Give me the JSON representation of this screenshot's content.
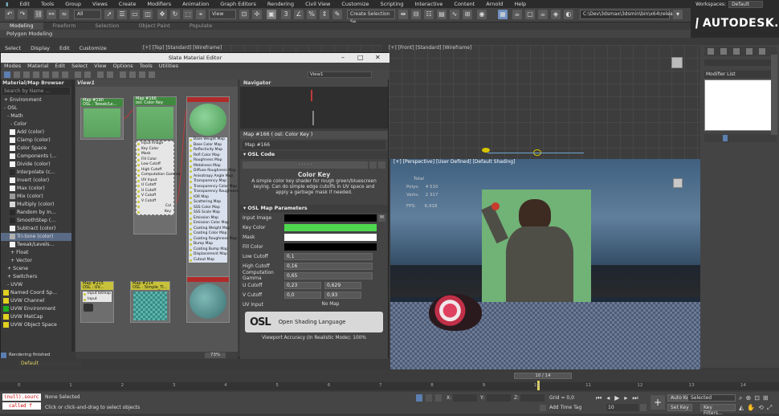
{
  "menubar": {
    "items": [
      "Edit",
      "Tools",
      "Group",
      "Views",
      "Create",
      "Modifiers",
      "Animation",
      "Graph Editors",
      "Rendering",
      "Civil View",
      "Customize",
      "Scripting",
      "Interactive",
      "Content",
      "Arnold",
      "Help"
    ],
    "file_icon": "F",
    "workspaces_label": "Workspaces:",
    "workspaces_value": "Default"
  },
  "toolbar": {
    "filter": "All",
    "view": "View",
    "selection_set": "Create Selection Se",
    "path": "C:\\Dev\\3dsmax\\3dsmin\\bin\\x64\\release"
  },
  "ribbon": {
    "tabs": [
      "Modeling",
      "Freeform",
      "Selection",
      "Object Paint",
      "Populate"
    ],
    "sub": "Polygon Modeling"
  },
  "brand": "AUTODESK.",
  "viewports": {
    "menu": [
      "Select",
      "Display",
      "Edit",
      "Customize"
    ],
    "top_label": "[+] [Top] [Standard] [Wireframe]",
    "front_label": "[+] [Front] [Standard] [Wireframe]",
    "persp_label": "[+] [Perspective] [User Defined] [Default Shading]",
    "stats": {
      "total_label": "Total",
      "polys_label": "Polys:",
      "polys": "4 510",
      "verts_label": "Verts:",
      "verts": "2 317",
      "fps_label": "FPS:",
      "fps": "6,918"
    }
  },
  "command_panel": {
    "modifier_list": "Modifier List"
  },
  "sme": {
    "title": "Slate Material Editor",
    "menu": [
      "Modes",
      "Material",
      "Edit",
      "Select",
      "View",
      "Options",
      "Tools",
      "Utilities"
    ],
    "view_dropdown": "View1",
    "browser": {
      "title": "Material/Map Browser",
      "search": "Search by Name ...",
      "items": [
        {
          "label": "+ Environment",
          "indent": 1,
          "swatch": ""
        },
        {
          "label": "- OSL",
          "indent": 1,
          "swatch": ""
        },
        {
          "label": "- Math",
          "indent": 2,
          "swatch": ""
        },
        {
          "label": "- Color",
          "indent": 3,
          "swatch": ""
        },
        {
          "label": "Add (color)",
          "indent": 5,
          "swatch": "#f4f4f4"
        },
        {
          "label": "Clamp (color)",
          "indent": 5,
          "swatch": "#f4f4f4"
        },
        {
          "label": "Color Space",
          "indent": 5,
          "swatch": "#f4f4f4"
        },
        {
          "label": "Components (...",
          "indent": 5,
          "swatch": "#f4f4f4"
        },
        {
          "label": "Divide (color)",
          "indent": 5,
          "swatch": "#f4f4f4"
        },
        {
          "label": "Interpolate (c...",
          "indent": 5,
          "swatch": "#2a2a2a"
        },
        {
          "label": "Invert (color)",
          "indent": 5,
          "swatch": "#f4f4f4"
        },
        {
          "label": "Max (color)",
          "indent": 5,
          "swatch": "#f4f4f4"
        },
        {
          "label": "Mix (color)",
          "indent": 5,
          "swatch": "#9a9a9a"
        },
        {
          "label": "Multiply (color)",
          "indent": 5,
          "swatch": "#d8d8d8"
        },
        {
          "label": "Random by In...",
          "indent": 5,
          "swatch": "#2a2a2a"
        },
        {
          "label": "SmoothStep (...",
          "indent": 5,
          "swatch": "#2a2a2a"
        },
        {
          "label": "Subtract (color)",
          "indent": 5,
          "swatch": "#f4f4f4"
        },
        {
          "label": "Tri-tone (color)",
          "indent": 5,
          "swatch": "#b0b0b0",
          "selected": true
        },
        {
          "label": "Tweak/Levels...",
          "indent": 5,
          "swatch": "#f4f4f4"
        },
        {
          "label": "+ Float",
          "indent": 3,
          "swatch": ""
        },
        {
          "label": "+ Vector",
          "indent": 3,
          "swatch": ""
        },
        {
          "label": "+ Scene",
          "indent": 2,
          "swatch": ""
        },
        {
          "label": "+ Switchers",
          "indent": 2,
          "swatch": ""
        },
        {
          "label": "- UVW",
          "indent": 2,
          "swatch": ""
        },
        {
          "label": "Named Coord Sp...",
          "indent": 3,
          "swatch": "#e0d020"
        },
        {
          "label": "UVW Channel",
          "indent": 3,
          "swatch": "#e0d020"
        },
        {
          "label": "UVW Environment",
          "indent": 3,
          "swatch": "#20b020"
        },
        {
          "label": "UVW MatCap",
          "indent": 3,
          "swatch": "#e0d020"
        },
        {
          "label": "UVW Object Space",
          "indent": 3,
          "swatch": "#e0d020"
        }
      ]
    },
    "view_tab": "View1",
    "nodes": {
      "n190": {
        "title": "Map #190",
        "sub": "OSL : Tweak/Le..."
      },
      "n166": {
        "title": "Map #166",
        "sub": "osl: Color Key",
        "slots": [
          "Input Image",
          "Key Color",
          "Mask",
          "Fill Color",
          "Low Cutoff",
          "High Cutoff",
          "Computation Gamma",
          "UV Input",
          "U Cutoff",
          "U Cutoff",
          "V Cutoff",
          "V Cutoff"
        ],
        "outs": [
          "Col",
          "Key"
        ]
      },
      "n3": {
        "title": "",
        "sub": "",
        "slots": [
          "Base Weight Map",
          "Base Color Map",
          "Reflectivity Map",
          "Refl Color Map",
          "Roughness Map",
          "Metalness Map",
          "Diffuse Roughness Map",
          "Anisotropy Angle Map",
          "Transparency Map",
          "Transparency Color Map",
          "Transparency Roughness",
          "IOR Map",
          "Scattering Map",
          "SSS Color Map",
          "SSS Scale Map",
          "Emission Map",
          "Emission Color Map",
          "Coating Weight Map",
          "Coating Color Map",
          "Coating Roughness Map",
          "Bump Map",
          "Coating Bump Map",
          "Displacement Map",
          "Cutout Map"
        ]
      },
      "n215": {
        "title": "Map #215",
        "sub": "OSL : UV...",
        "slots": [
          "Input bitmap",
          "Input"
        ]
      },
      "n214": {
        "title": "Map #214",
        "sub": "OSL : Simple_Ti..."
      }
    },
    "zoom": "73%",
    "navigator": {
      "title": "Navigator"
    },
    "props": {
      "header": "Map #166  ( osl: Color Key )",
      "map_name": "Map #166",
      "osl_code": "OSL Code",
      "dots": "· · · · ·",
      "desc_title": "Color Key",
      "desc": "A simple color key shader for rough green/bluescreen keying. Can do simple edge cutoffs in UV space and apply a garbage mask if needed.",
      "params_title": "OSL Map Parameters",
      "params": {
        "input_image": "Input Image",
        "input_m": "M",
        "key_color": "Key Color",
        "mask": "Mask",
        "fill_color": "Fill Color",
        "low_cutoff": "Low Cutoff",
        "low_cutoff_v": "0,1",
        "high_cutoff": "High Cutoff",
        "high_cutoff_v": "0,16",
        "gamma": "Computation Gamma",
        "gamma_v": "0,65",
        "u_cutoff": "U Cutoff",
        "u_cutoff_a": "0,23",
        "u_cutoff_b": "0,629",
        "v_cutoff": "V Cutoff",
        "v_cutoff_a": "0,0",
        "v_cutoff_b": "0,93",
        "uv_input": "UV Input",
        "no_map": "No Map"
      },
      "osl_logo": "OSL",
      "osl_tagline": "Open Shading Language",
      "accuracy": "Viewport Accuracy (In Realistic Mode): 100%"
    },
    "rendering": "Rendering finished"
  },
  "colors": {
    "key_color": "#4fd84f",
    "mask": "#ffffff",
    "fill_color": "#000000",
    "input_image": "#000000"
  },
  "timeline": {
    "layer": "Default",
    "frame": "10 / 14",
    "ticks": [
      "0",
      "1",
      "2",
      "3",
      "4",
      "5",
      "6",
      "7",
      "8",
      "9",
      "10",
      "11",
      "12",
      "13",
      "14"
    ]
  },
  "status": {
    "maxscript1": "(null).sourc",
    "maxscript2": "called f",
    "selection": "None Selected",
    "prompt": "Click or click-and-drag to select objects",
    "x": "X:",
    "y": "Y:",
    "z": "Z:",
    "grid": "Grid = 0,0",
    "add_time_tag": "Add Time Tag",
    "frame": "10",
    "auto_key": "Auto Key",
    "selected": "Selected",
    "set_key": "Set Key",
    "key_filters": "Key Filters..."
  }
}
